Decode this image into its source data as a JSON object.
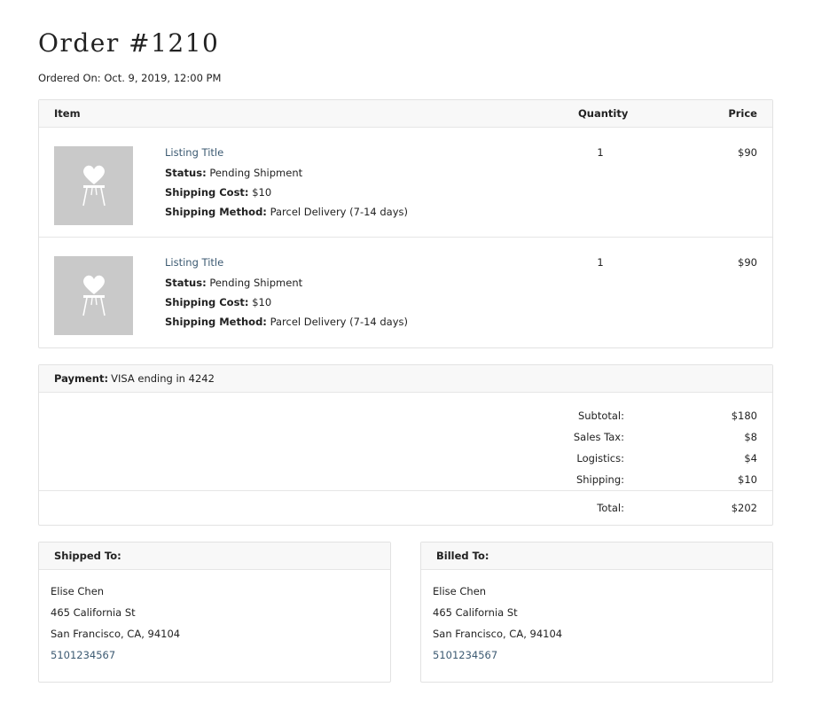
{
  "order": {
    "title": "Order #1210",
    "ordered_on_label": "Ordered On:",
    "ordered_on_value": "Oct. 9, 2019, 12:00 PM"
  },
  "items_table": {
    "headers": {
      "item": "Item",
      "quantity": "Quantity",
      "price": "Price"
    },
    "rows": [
      {
        "thumbnail_icon": "chair-heart-icon",
        "listing_title": "Listing Title",
        "status_label": "Status:",
        "status_value": "Pending Shipment",
        "shipping_cost_label": "Shipping Cost:",
        "shipping_cost_value": "$10",
        "shipping_method_label": "Shipping Method:",
        "shipping_method_value": "Parcel Delivery (7-14 days)",
        "quantity": "1",
        "price": "$90"
      },
      {
        "thumbnail_icon": "chair-heart-icon",
        "listing_title": "Listing Title",
        "status_label": "Status:",
        "status_value": "Pending Shipment",
        "shipping_cost_label": "Shipping Cost:",
        "shipping_cost_value": "$10",
        "shipping_method_label": "Shipping Method:",
        "shipping_method_value": "Parcel Delivery (7-14 days)",
        "quantity": "1",
        "price": "$90"
      }
    ]
  },
  "payment": {
    "label": "Payment:",
    "value": "VISA ending in 4242",
    "lines": [
      {
        "label": "Subtotal:",
        "value": "$180"
      },
      {
        "label": "Sales Tax:",
        "value": "$8"
      },
      {
        "label": "Logistics:",
        "value": "$4"
      },
      {
        "label": "Shipping:",
        "value": "$10"
      }
    ],
    "total_label": "Total:",
    "total_value": "$202"
  },
  "shipped_to": {
    "heading": "Shipped To:",
    "name": "Elise Chen",
    "street": "465 California St",
    "city_line": "San Francisco, CA, 94104",
    "phone": "5101234567"
  },
  "billed_to": {
    "heading": "Billed To:",
    "name": "Elise Chen",
    "street": "465 California St",
    "city_line": "San Francisco, CA, 94104",
    "phone": "5101234567"
  },
  "colors": {
    "link": "#3c5a72",
    "thumbnail_bg": "#c9c9c9",
    "header_bg": "#f8f8f8",
    "border": "#e2e2e2"
  }
}
